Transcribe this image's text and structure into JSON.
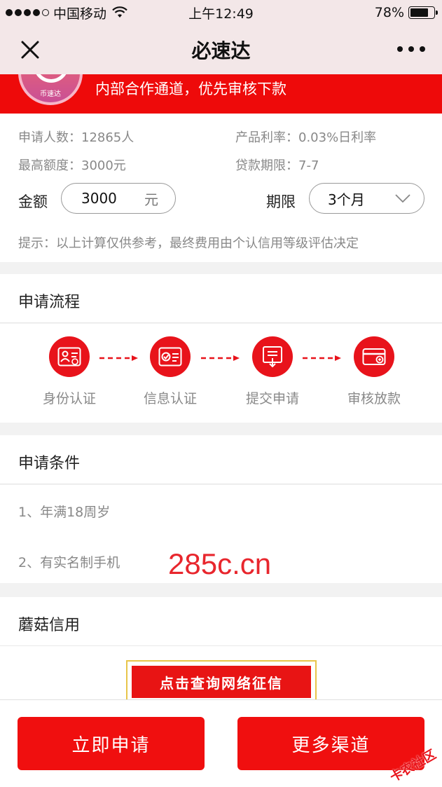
{
  "status_bar": {
    "carrier": "中国移动",
    "time": "上午12:49",
    "battery_percent": "78%",
    "battery_level": 0.78
  },
  "nav": {
    "title": "必速达"
  },
  "banner": {
    "logo_text": "币速达",
    "text": "内部合作通道，优先审核下款"
  },
  "product_info": {
    "applicants": "申请人数：12865人",
    "rate": "产品利率：0.03%日利率",
    "max_amount": "最高额度：3000元",
    "term_range": "贷款期限：7-7"
  },
  "calculator": {
    "amount_label": "金额",
    "amount_value": "3000",
    "amount_unit": "元",
    "term_label": "期限",
    "term_value": "3个月",
    "hint": "提示：以上计算仅供参考，最终费用由个认信用等级评估决定"
  },
  "process": {
    "title": "申请流程",
    "steps": [
      {
        "label": "身份认证",
        "icon": "id-card-icon"
      },
      {
        "label": "信息认证",
        "icon": "verified-card-icon"
      },
      {
        "label": "提交申请",
        "icon": "submit-form-icon"
      },
      {
        "label": "审核放款",
        "icon": "payment-card-icon"
      }
    ]
  },
  "conditions": {
    "title": "申请条件",
    "items": [
      "1、年满18周岁",
      "2、有实名制手机"
    ]
  },
  "watermark": "285c.cn",
  "credit": {
    "title": "蘑菇信用",
    "button": "点击查询网络征信"
  },
  "actions": {
    "apply": "立即申请",
    "more": "更多渠道"
  },
  "corner_watermark": "卡农社区",
  "colors": {
    "brand_red": "#ee0a0a",
    "nav_bg": "#f3e7e8"
  }
}
